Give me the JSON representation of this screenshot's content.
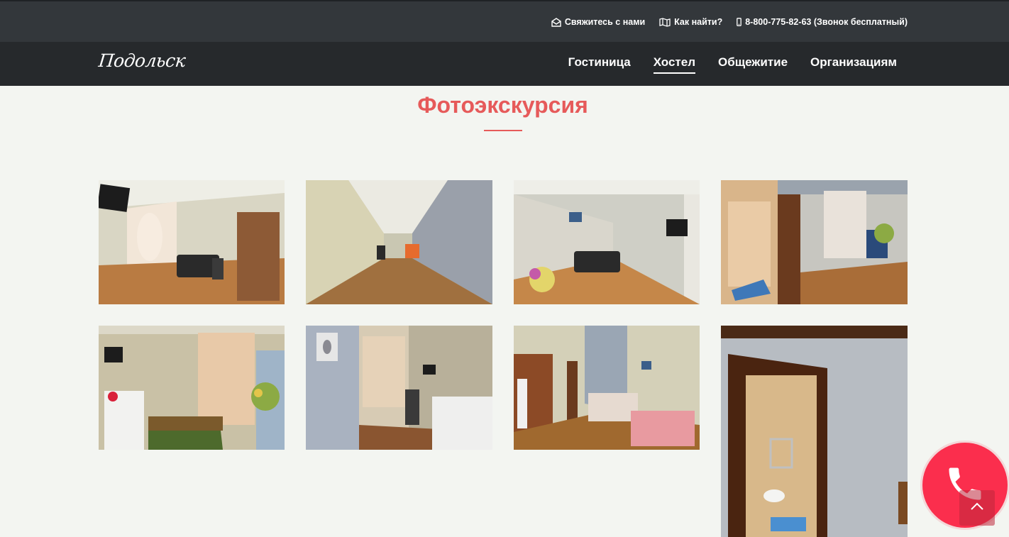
{
  "topbar": {
    "contact_label": "Свяжитесь с нами",
    "directions_label": "Как найти?",
    "phone_label": "8-800-775-82-63 (Звонок бесплатный)"
  },
  "navbar": {
    "logo_text": "Подольск",
    "menu": [
      {
        "label": "Гостиница"
      },
      {
        "label": "Хостел",
        "active": true
      },
      {
        "label": "Общежитие"
      },
      {
        "label": "Организациям"
      }
    ]
  },
  "section": {
    "title": "Фотоэкскурсия"
  },
  "colors": {
    "accent": "#e65a5a",
    "topbar_bg": "#33373b",
    "navbar_bg": "#26292c",
    "call_button": "#fb2e4d"
  },
  "icons": {
    "contact": "envelope-open-icon",
    "directions": "map-icon",
    "phone": "mobile-phone-icon",
    "call": "phone-handset-icon",
    "scroll_top": "chevron-up-icon"
  }
}
